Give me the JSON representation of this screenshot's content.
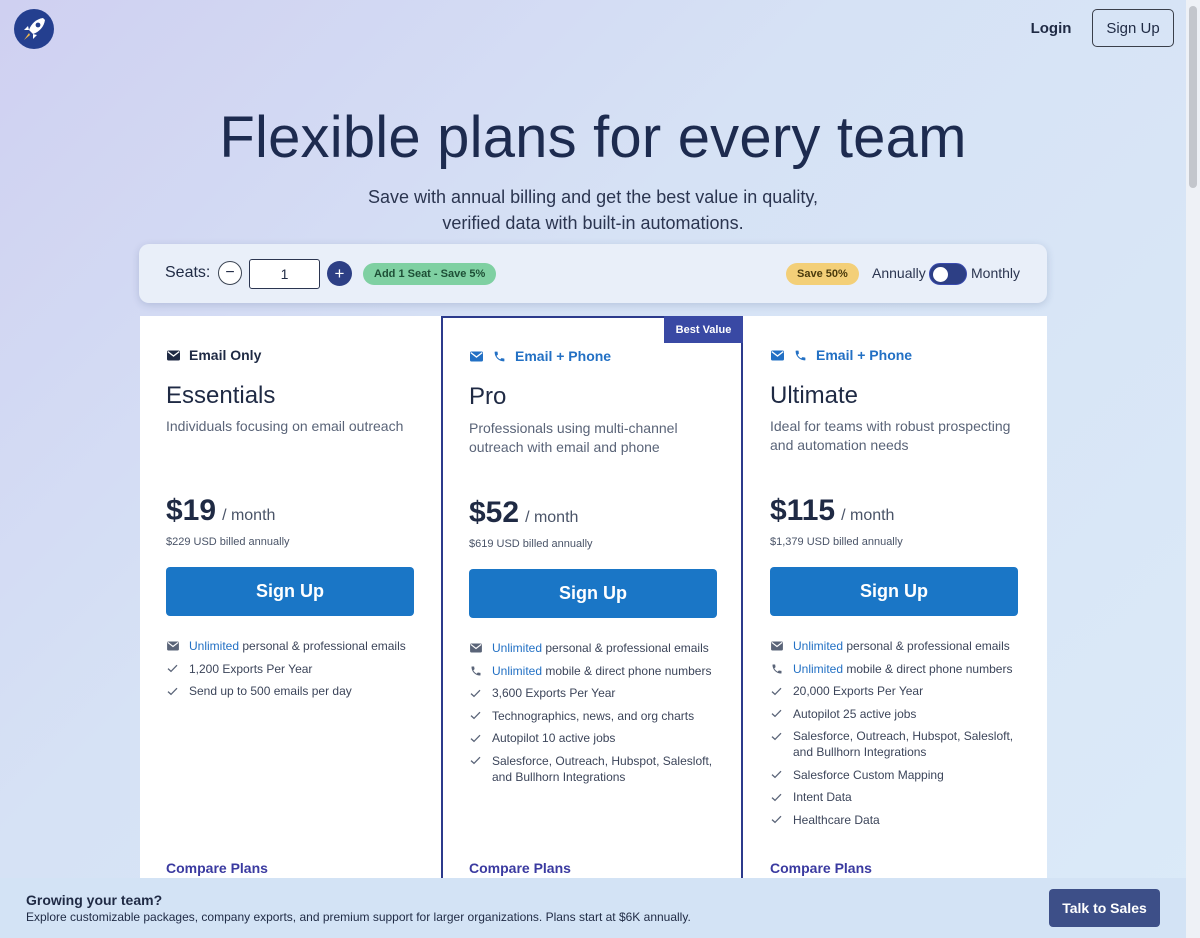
{
  "nav": {
    "login": "Login",
    "signup": "Sign Up"
  },
  "hero": {
    "title": "Flexible plans for every team",
    "subtitle_line1": "Save with annual billing and get the best value in quality,",
    "subtitle_line2": "verified data with built-in automations."
  },
  "controls": {
    "seats_label": "Seats:",
    "seats_value": "1",
    "minus": "−",
    "plus": "+",
    "seat_badge": "Add 1 Seat - Save 5%",
    "save_badge": "Save 50%",
    "annually": "Annually",
    "monthly": "Monthly",
    "billing_toggle": "annually"
  },
  "colors": {
    "primary": "#1a76c6",
    "navy": "#2d3f85",
    "accent_blue": "#2270c4",
    "badge_green": "#7fd0a2",
    "badge_yellow": "#f3cf78"
  },
  "plans": [
    {
      "tag": "Email Only",
      "icons": [
        "envelope-icon"
      ],
      "name": "Essentials",
      "desc": "Individuals focusing on email outreach",
      "price": "$19",
      "per": "/ month",
      "billed": "$229 USD billed annually",
      "cta": "Sign Up",
      "features": [
        {
          "icon": "envelope-icon",
          "hl": "Unlimited",
          "text": " personal & professional emails"
        },
        {
          "icon": "check-icon",
          "hl": "",
          "text": "1,200 Exports Per Year"
        },
        {
          "icon": "check-icon",
          "hl": "",
          "text": "Send up to 500 emails per day"
        }
      ],
      "compare": "Compare Plans"
    },
    {
      "badge": "Best Value",
      "tag": "Email + Phone",
      "icons": [
        "envelope-icon",
        "phone-icon"
      ],
      "name": "Pro",
      "desc": "Professionals using multi-channel outreach with email and phone",
      "price": "$52",
      "per": "/ month",
      "billed": "$619 USD billed annually",
      "cta": "Sign Up",
      "features": [
        {
          "icon": "envelope-icon",
          "hl": "Unlimited",
          "text": " personal & professional emails"
        },
        {
          "icon": "phone-icon",
          "hl": "Unlimited",
          "text": " mobile & direct phone numbers"
        },
        {
          "icon": "check-icon",
          "hl": "",
          "text": "3,600 Exports Per Year"
        },
        {
          "icon": "check-icon",
          "hl": "",
          "text": "Technographics, news, and org charts"
        },
        {
          "icon": "check-icon",
          "hl": "",
          "text": "Autopilot 10 active jobs"
        },
        {
          "icon": "check-icon",
          "hl": "",
          "text": "Salesforce, Outreach, Hubspot, Salesloft, and Bullhorn Integrations"
        }
      ],
      "compare": "Compare Plans"
    },
    {
      "tag": "Email + Phone",
      "icons": [
        "envelope-icon",
        "phone-icon"
      ],
      "name": "Ultimate",
      "desc": "Ideal for teams with robust prospecting and automation needs",
      "price": "$115",
      "per": "/ month",
      "billed": "$1,379 USD billed annually",
      "cta": "Sign Up",
      "features": [
        {
          "icon": "envelope-icon",
          "hl": "Unlimited",
          "text": " personal & professional emails"
        },
        {
          "icon": "phone-icon",
          "hl": "Unlimited",
          "text": " mobile & direct phone numbers"
        },
        {
          "icon": "check-icon",
          "hl": "",
          "text": "20,000 Exports Per Year"
        },
        {
          "icon": "check-icon",
          "hl": "",
          "text": "Autopilot 25 active jobs"
        },
        {
          "icon": "check-icon",
          "hl": "",
          "text": "Salesforce, Outreach, Hubspot, Salesloft, and Bullhorn Integrations"
        },
        {
          "icon": "check-icon",
          "hl": "",
          "text": "Salesforce Custom Mapping"
        },
        {
          "icon": "check-icon",
          "hl": "",
          "text": "Intent Data"
        },
        {
          "icon": "check-icon",
          "hl": "",
          "text": "Healthcare Data"
        }
      ],
      "compare": "Compare Plans"
    }
  ],
  "banner": {
    "title": "Growing your team?",
    "text": "Explore customizable packages, company exports, and premium support for larger organizations. Plans start at $6K annually.",
    "cta": "Talk to Sales"
  }
}
